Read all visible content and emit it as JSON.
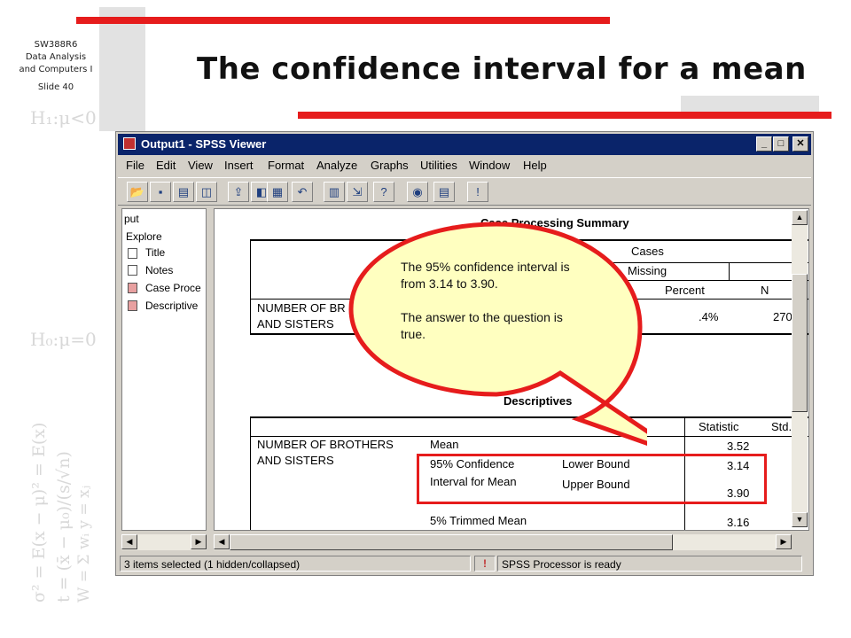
{
  "slide": {
    "course_code": "SW388R6",
    "course_line2": "Data Analysis",
    "course_line3": "and Computers I",
    "slide_label": "Slide 40",
    "title": "The confidence interval for a mean"
  },
  "window": {
    "title": "Output1 - SPSS Viewer",
    "minimize": "_",
    "maximize": "□",
    "close": "✕"
  },
  "menu": [
    "File",
    "Edit",
    "View",
    "Insert",
    "Format",
    "Analyze",
    "Graphs",
    "Utilities",
    "Window",
    "Help"
  ],
  "outline": {
    "items": [
      "put",
      "Explore",
      "Title",
      "Notes",
      "Case Proce",
      "Descriptive"
    ]
  },
  "case_summary": {
    "title": "Case Processing Summary",
    "header_cases": "Cases",
    "header_missing": "Missing",
    "col_percent": "Percent",
    "col_n": "N",
    "row_label_1": "NUMBER OF BR",
    "row_label_2": "AND SISTERS",
    "percent_value": ".4%",
    "n_value": "270"
  },
  "descriptives": {
    "title": "Descriptives",
    "col_statistic": "Statistic",
    "col_std": "Std.",
    "var_line1": "NUMBER OF BROTHERS",
    "var_line2": "AND SISTERS",
    "mean_label": "Mean",
    "mean_value": "3.52",
    "ci_label_1": "95% Confidence",
    "ci_label_2": "Interval for Mean",
    "lower_label": "Lower Bound",
    "lower_value": "3.14",
    "upper_label": "Upper Bound",
    "upper_value": "3.90",
    "trimmed_label": "5% Trimmed Mean",
    "trimmed_value": "3.16"
  },
  "status": {
    "selection": "3 items selected (1 hidden/collapsed)",
    "processor": "SPSS Processor  is ready"
  },
  "callout": {
    "line1": "The 95% confidence interval is from 3.14 to 3.90.",
    "line2": "The answer to the question is true."
  },
  "colors": {
    "accent_red": "#e61c1c",
    "callout_fill": "#ffffc0",
    "titlebar": "#0a246a"
  }
}
